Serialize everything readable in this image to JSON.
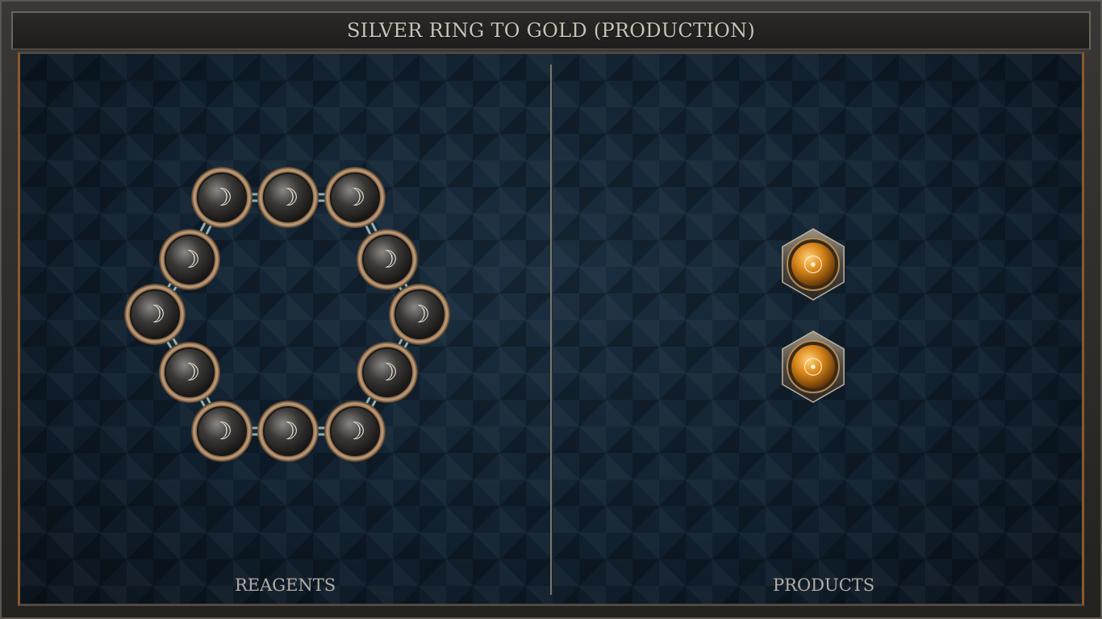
{
  "title": "SILVER RING TO GOLD (PRODUCTION)",
  "panels": {
    "reagents_label": "REAGENTS",
    "products_label": "PRODUCTS"
  },
  "reagents": {
    "atom_type": "silver",
    "atom_symbol": "☽",
    "count": 12,
    "arrangement": "ring",
    "colors": {
      "atom": "#3c3a38",
      "rim": "#c7a17a",
      "glyph": "#f1e6d6",
      "bond": "#8fb0b6"
    }
  },
  "products": {
    "atom_type": "gold",
    "atom_symbol": "☉",
    "count": 2,
    "colors": {
      "atom": "#e38f1f",
      "rim": "#8a8070",
      "glyph": "#fff1d0"
    }
  }
}
